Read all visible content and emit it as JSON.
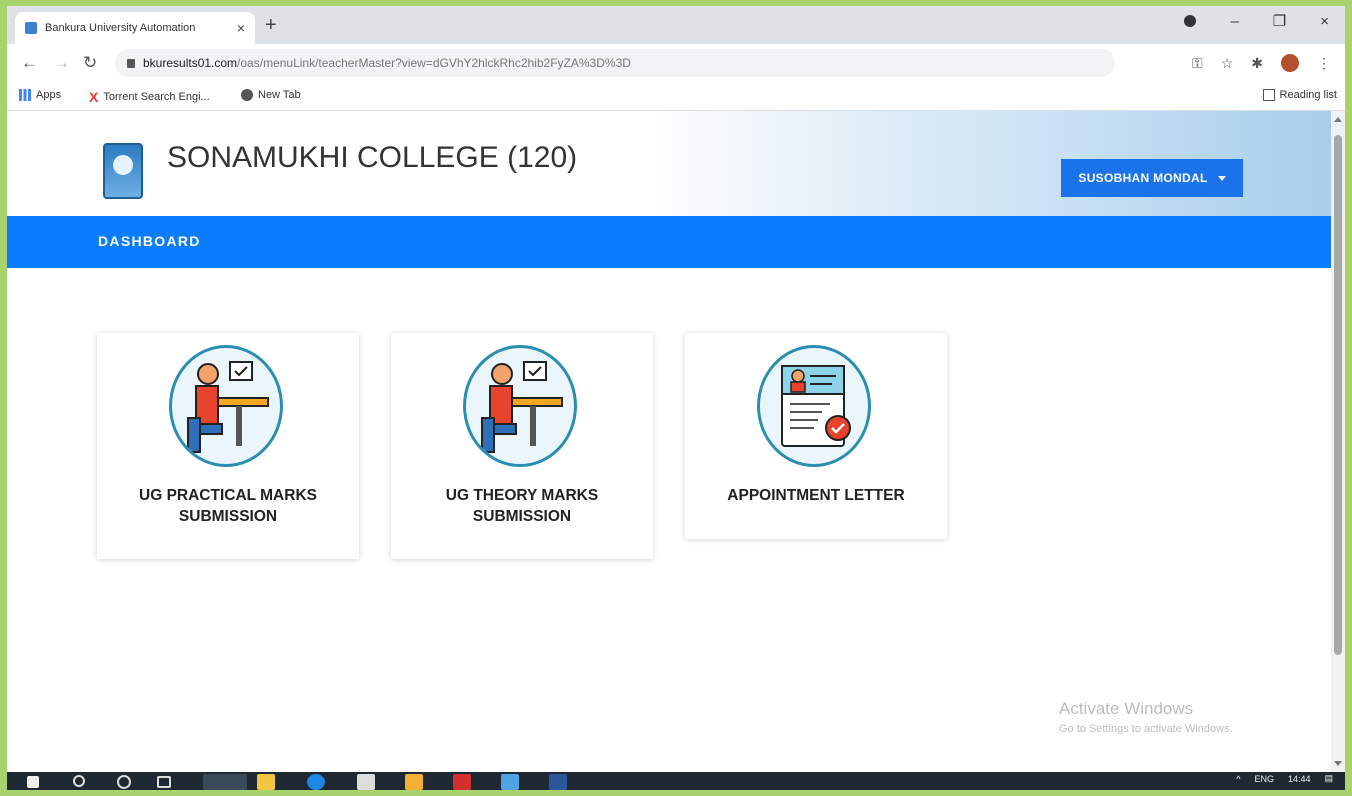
{
  "browser": {
    "tab_title": "Bankura University Automation",
    "tab_close": "×",
    "new_tab": "+",
    "url_host": "bkuresults01.com",
    "url_path": "/oas/menuLink/teacherMaster?view=dGVhY2hlckRhc2hib2FyZA%3D%3D",
    "bookmarks": [
      {
        "label": "Apps",
        "icon": "apps-grid-icon",
        "color": "#4285f4"
      },
      {
        "label": "Torrent Search Engi...",
        "icon": "torrent-x-icon",
        "color": "#e53935"
      },
      {
        "label": "New Tab",
        "icon": "globe-icon",
        "color": "#555555"
      }
    ],
    "reading_list": "Reading list",
    "window_controls": {
      "minimize": "–",
      "restore": "❐",
      "close": "×"
    }
  },
  "page": {
    "college_name": "SONAMUKHI COLLEGE (120)",
    "user_menu": "SUSOBHAN MONDAL",
    "nav": {
      "dashboard": "DASHBOARD"
    },
    "cards": [
      {
        "line1": "UG PRACTICAL MARKS",
        "line2": "SUBMISSION",
        "icon": "teacher-at-desk-icon"
      },
      {
        "line1": "UG THEORY MARKS",
        "line2": "SUBMISSION",
        "icon": "teacher-at-desk-icon"
      },
      {
        "line1": "APPOINTMENT LETTER",
        "line2": "",
        "icon": "id-document-icon"
      }
    ],
    "watermark": {
      "line1": "Activate Windows",
      "line2": "Go to Settings to activate Windows."
    }
  },
  "taskbar": {
    "time": "14:44",
    "lang": "ENG"
  },
  "colors": {
    "primary_blue": "#0a7cff",
    "button_blue": "#1a73e8",
    "icon_ring": "#2b8eb1"
  }
}
